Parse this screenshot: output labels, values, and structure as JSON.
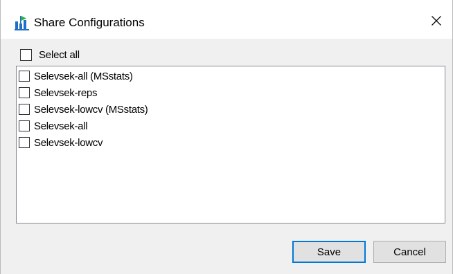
{
  "window": {
    "title": "Share Configurations",
    "app_icon": "chart-flag-icon",
    "close_glyph": "✕"
  },
  "select_all": {
    "label": "Select all",
    "checked": false
  },
  "configurations": [
    {
      "label": "Selevsek-all (MSstats)",
      "checked": false
    },
    {
      "label": "Selevsek-reps",
      "checked": false
    },
    {
      "label": "Selevsek-lowcv (MSstats)",
      "checked": false
    },
    {
      "label": "Selevsek-all",
      "checked": false
    },
    {
      "label": "Selevsek-lowcv",
      "checked": false
    }
  ],
  "buttons": {
    "save_label": "Save",
    "cancel_label": "Cancel"
  },
  "colors": {
    "default_button_border": "#0078d7",
    "icon_blue": "#1f6fc2",
    "icon_green": "#2bb34a"
  }
}
